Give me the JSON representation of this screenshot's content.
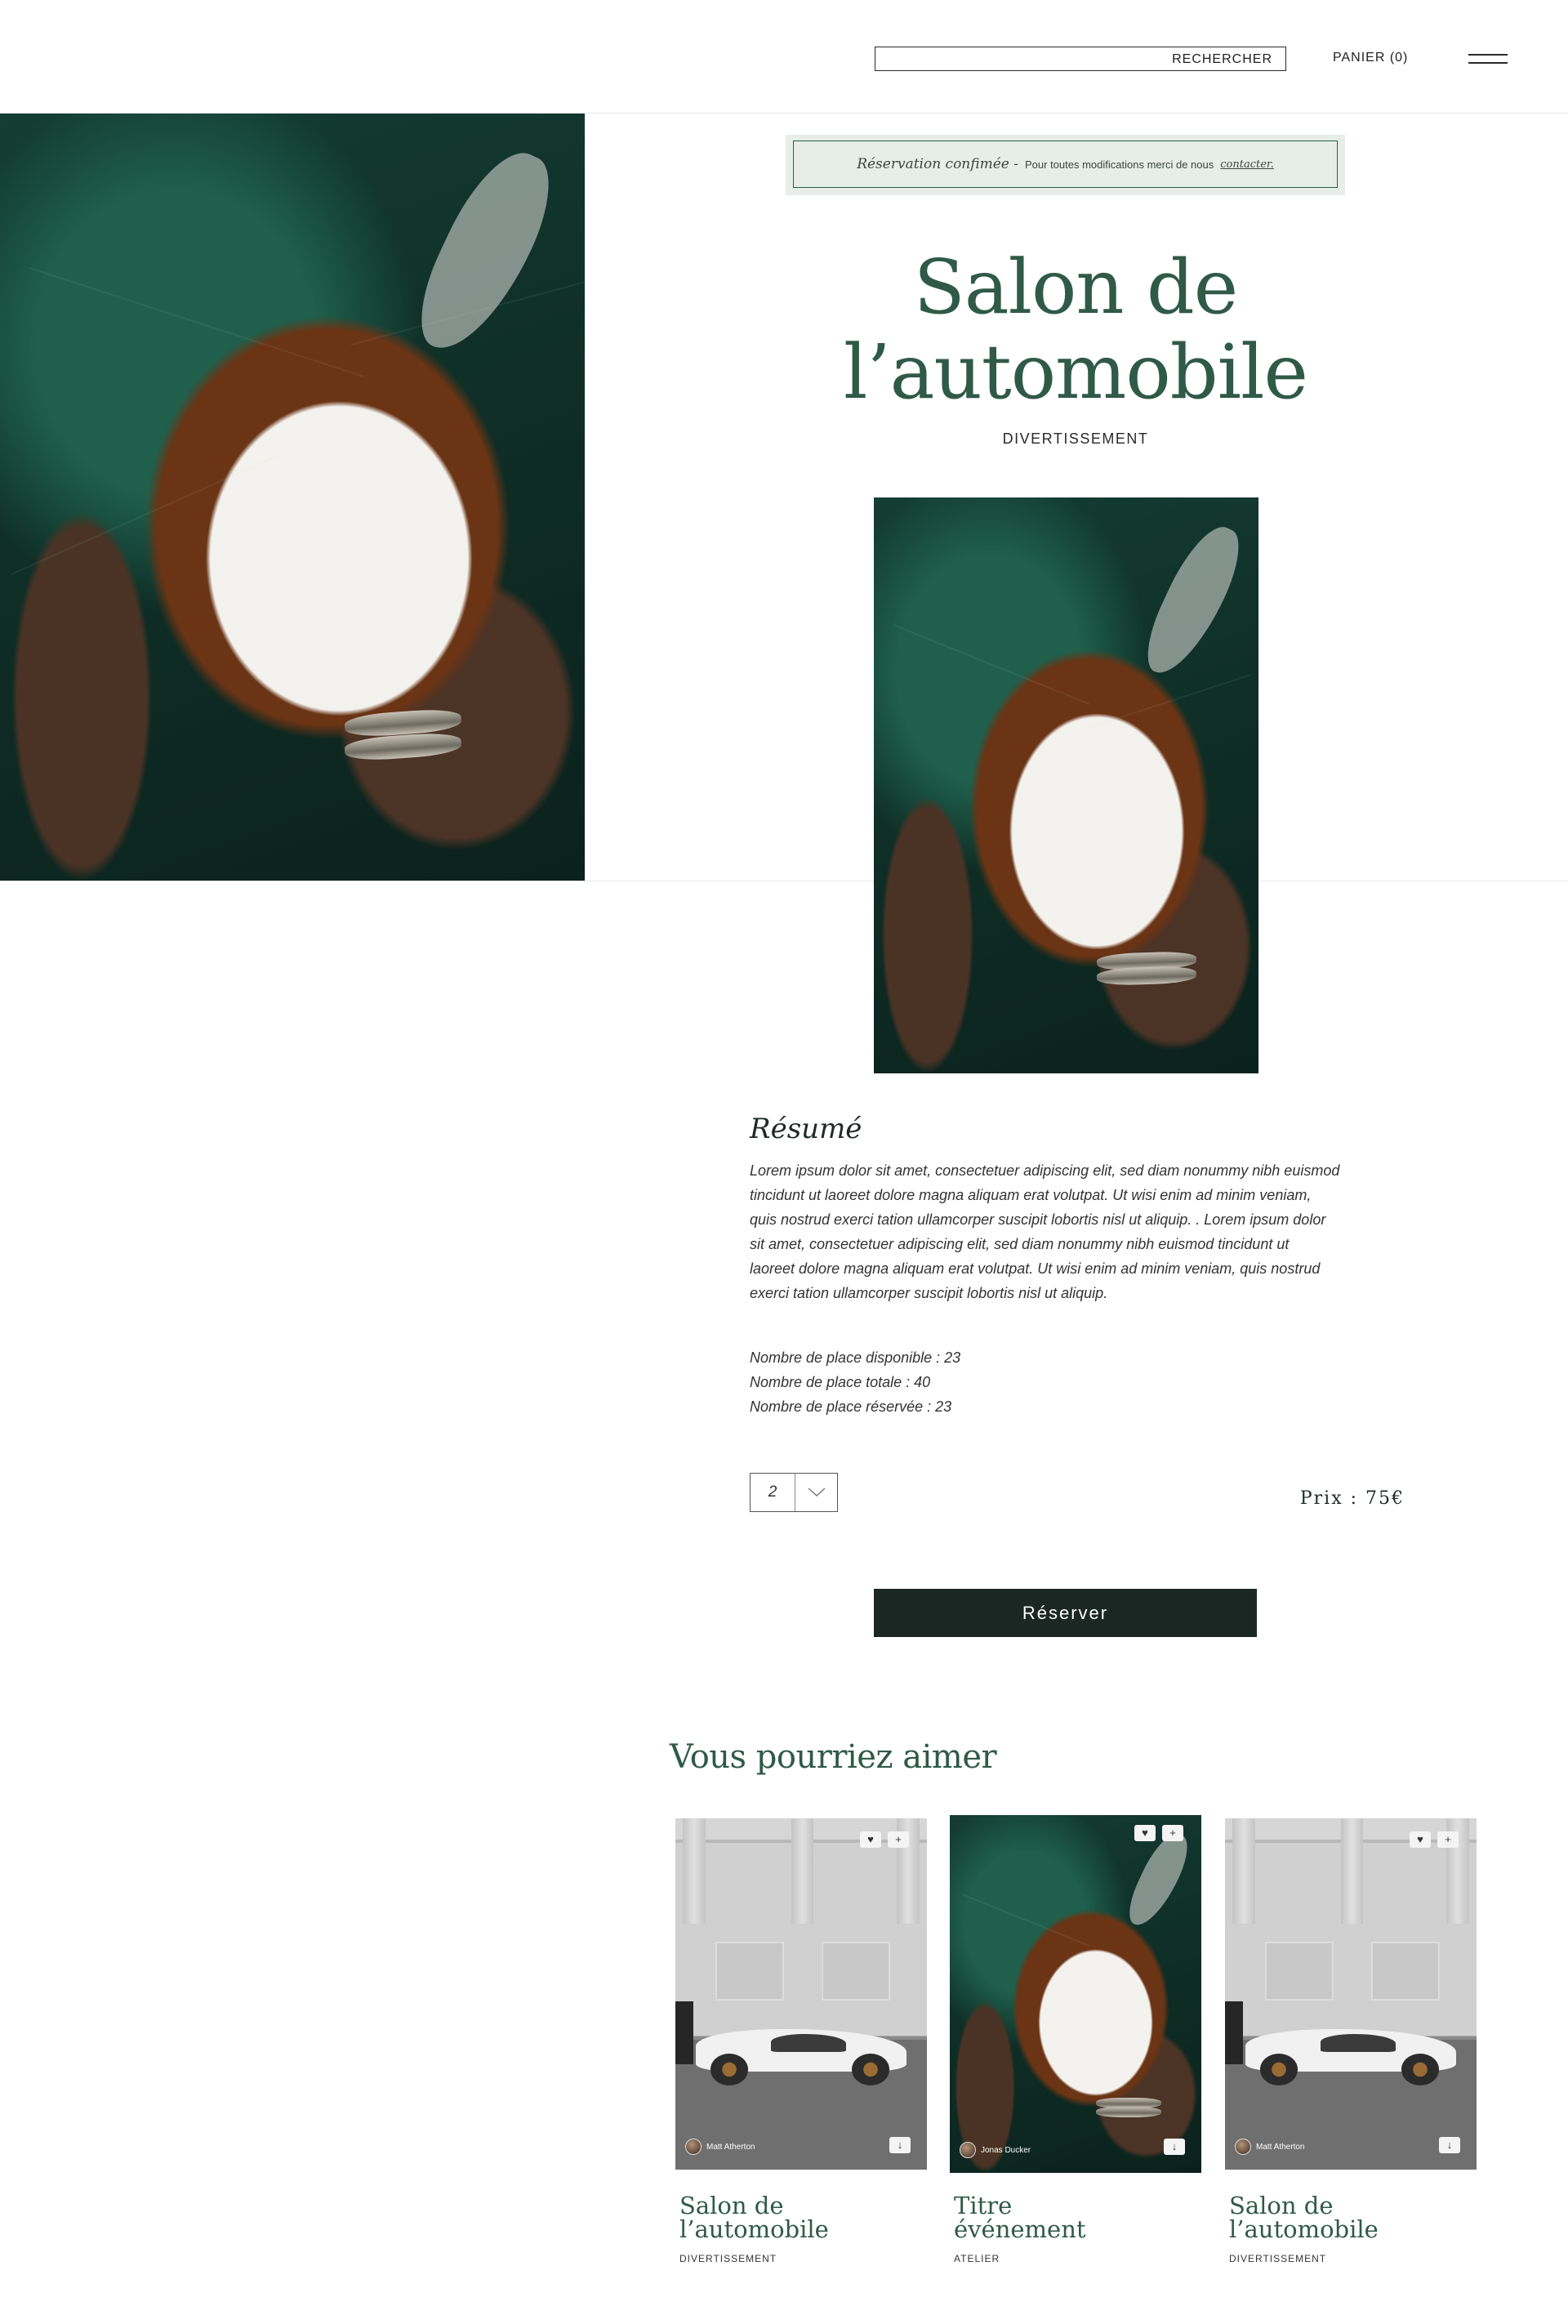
{
  "header": {
    "search_label": "RECHERCHER",
    "cart_label": "PANIER (0)"
  },
  "notice": {
    "main": "Réservation confimée -",
    "detail": "Pour toutes modifications merci de nous",
    "link": "contacter."
  },
  "event": {
    "title_line1": "Salon de",
    "title_line2": "l’automobile",
    "category": "DIVERTISSEMENT"
  },
  "summary": {
    "heading": "Résumé",
    "lines": [
      "Lorem ipsum dolor sit amet, consectetuer adipiscing elit, sed diam nonummy nibh euismod",
      "tincidunt ut laoreet dolore magna aliquam erat volutpat. Ut wisi enim ad minim veniam,",
      "quis nostrud exerci tation ullamcorper suscipit lobortis nisl ut aliquip. . Lorem ipsum dolor",
      "sit amet, consectetuer adipiscing elit, sed diam nonummy nibh euismod tincidunt ut",
      "laoreet dolore magna aliquam erat volutpat. Ut wisi enim ad minim veniam, quis nostrud",
      "exerci tation ullamcorper suscipit lobortis nisl ut aliquip."
    ]
  },
  "seats": {
    "available": "Nombre de place disponible : 23",
    "total": "Nombre de place totale : 40",
    "reserved": "Nombre de place réservée : 23"
  },
  "booking": {
    "quantity": "2",
    "price": "Prix  :  75€",
    "reserve_label": "Réserver"
  },
  "suggestions": {
    "heading": "Vous pourriez aimer",
    "cards": [
      {
        "title_line1": "Salon de",
        "title_line2": "l’automobile",
        "category": "DIVERTISSEMENT",
        "credit": "Matt Atherton",
        "image": "car"
      },
      {
        "title_line1": "Titre",
        "title_line2": "événement",
        "category": "ATELIER",
        "credit": "Jonas Ducker",
        "image": "coconut"
      },
      {
        "title_line1": "Salon de",
        "title_line2": "l’automobile",
        "category": "DIVERTISSEMENT",
        "credit": "Matt Atherton",
        "image": "car"
      }
    ]
  },
  "icons": {
    "menu": "hamburger-icon",
    "like": "heart-icon",
    "add": "plus-icon",
    "download": "download-icon",
    "dropdown": "chevron-down-icon"
  },
  "colors": {
    "accent_green": "#2f5a47",
    "button_dark": "#1b2723",
    "notice_bg": "#e7eeea"
  }
}
